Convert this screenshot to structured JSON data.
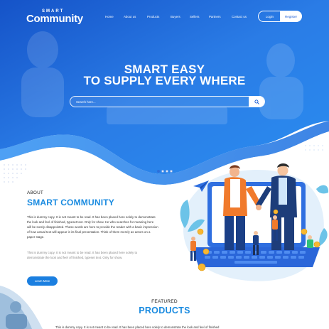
{
  "brand": {
    "small": "SMART",
    "big": "Community"
  },
  "nav": {
    "items": [
      {
        "label": "Home"
      },
      {
        "label": "About us"
      },
      {
        "label": "Products"
      },
      {
        "label": "Buyers"
      },
      {
        "label": "Sellers"
      },
      {
        "label": "Partners"
      },
      {
        "label": "Contact us"
      }
    ],
    "login": "Login",
    "register": "Register"
  },
  "hero": {
    "headline_line1": "SMART EASY",
    "headline_line2": "TO SUPPLY EVERY WHERE",
    "search_placeholder": "Search here...",
    "slides_total": 4,
    "slide_active": 1
  },
  "about": {
    "kicker": "ABOUT",
    "title": "SMART COMMUNITY",
    "paragraph1": "This is dummy copy. It is not meant to be read. It has been placed here solely to demonstrate the look and feel of finished, typeset text. Only for show. He who searches for meaning here will be sorely disappointed. These words are here to provide the reader with a basic impression of how actual text will appear in its final presentation. Think of them merely as actors on a paper stage.",
    "paragraph2": "This is dummy copy. It is not meant to be read. It has been placed here solely to demonstrate the look and feel of finished, typeset text. Only for show.",
    "button": "Learn More"
  },
  "products": {
    "kicker": "FEATURED",
    "title": "PRODUCTS",
    "description": "This is dummy copy. It is not meant to be read. It has been placed here solely to demonstrate the look and feel of finished"
  },
  "colors": {
    "primary": "#1a8be0",
    "hero_dark": "#1556c9",
    "hero_light": "#2f8ef0",
    "button": "#1b7fe0"
  },
  "icons": {
    "search": "search-icon",
    "paper_plane": "paper-plane-icon"
  }
}
